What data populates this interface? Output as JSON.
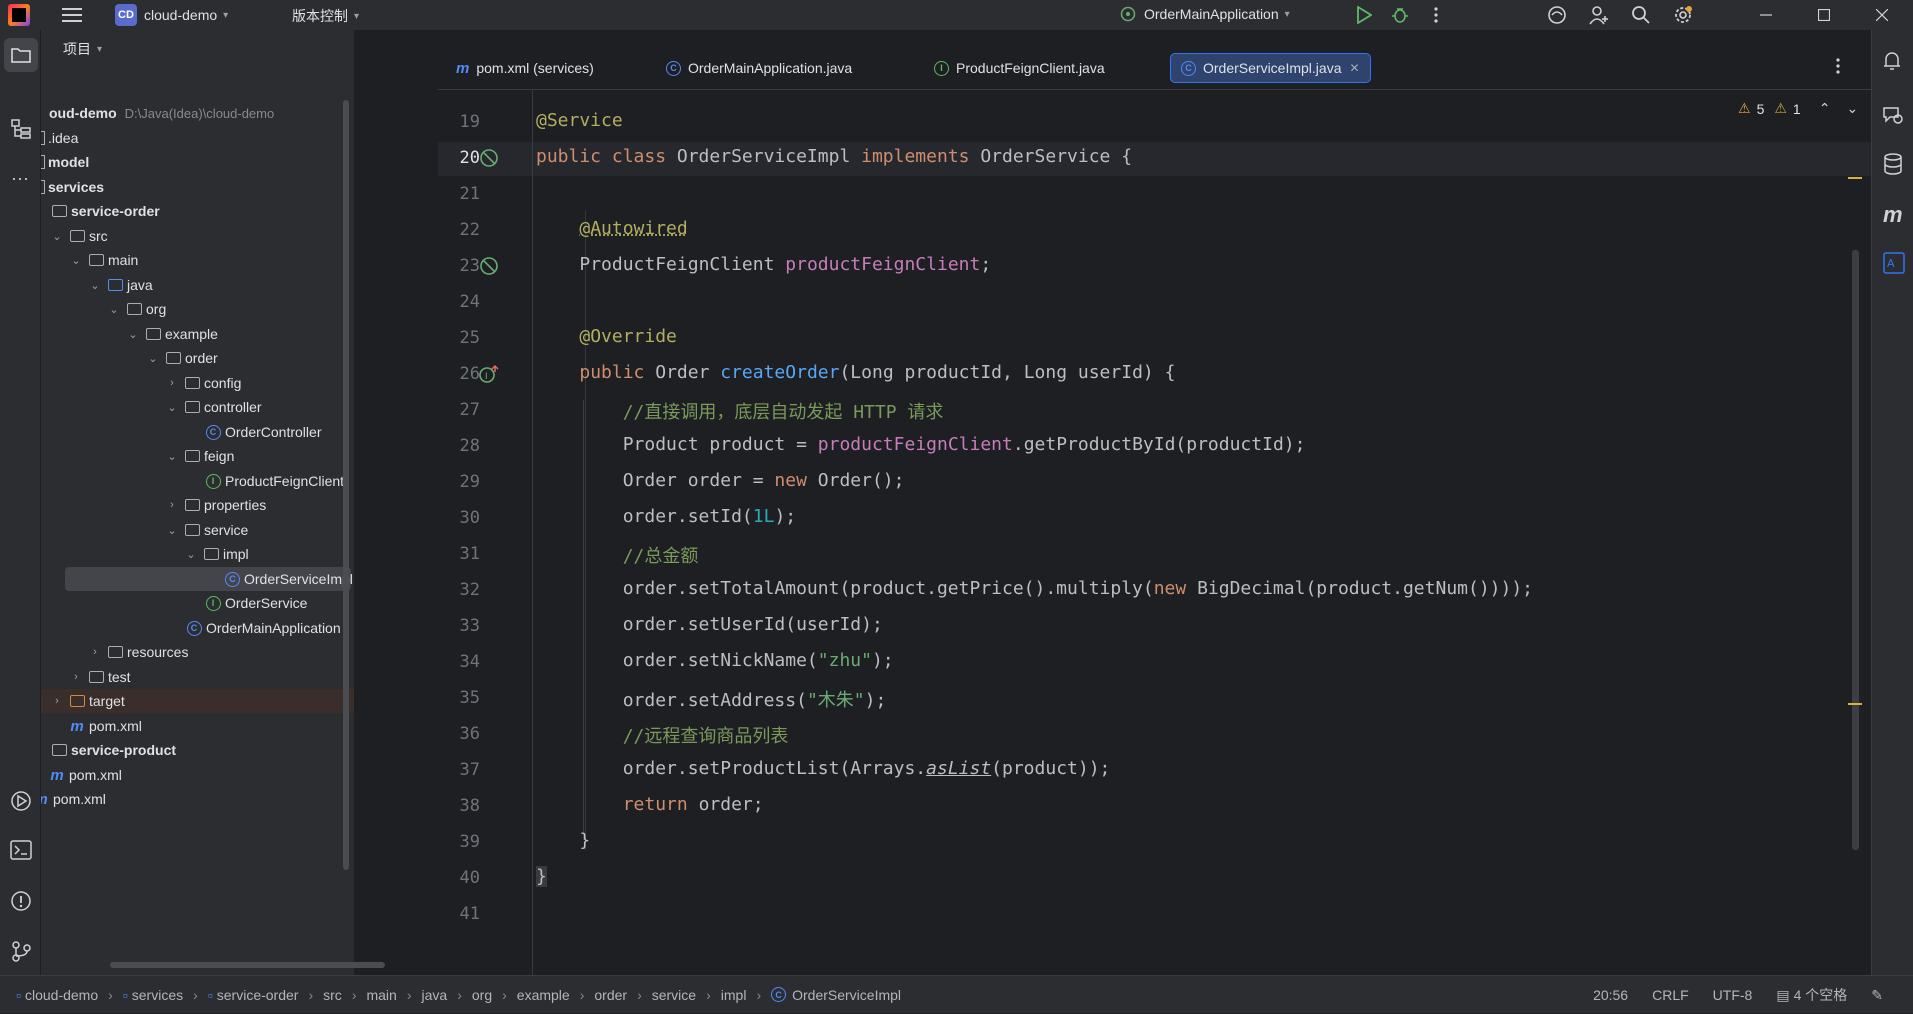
{
  "titlebar": {
    "project_badge": "CD",
    "project_name": "cloud-demo",
    "vcs_label": "版本控制",
    "run_config": "OrderMainApplication"
  },
  "project_panel": {
    "title": "项目",
    "root": {
      "name": "oud-demo",
      "path": "D:\\Java(Idea)\\cloud-demo"
    },
    "items": [
      {
        "label": ".idea"
      },
      {
        "label": "model"
      },
      {
        "label": "services"
      },
      {
        "label": "service-order"
      },
      {
        "label": "src"
      },
      {
        "label": "main"
      },
      {
        "label": "java"
      },
      {
        "label": "org"
      },
      {
        "label": "example"
      },
      {
        "label": "order"
      },
      {
        "label": "config"
      },
      {
        "label": "controller"
      },
      {
        "label": "OrderController"
      },
      {
        "label": "feign"
      },
      {
        "label": "ProductFeignClient"
      },
      {
        "label": "properties"
      },
      {
        "label": "service"
      },
      {
        "label": "impl"
      },
      {
        "label": "OrderServiceImpl"
      },
      {
        "label": "OrderService"
      },
      {
        "label": "OrderMainApplication"
      },
      {
        "label": "resources"
      },
      {
        "label": "test"
      },
      {
        "label": "target"
      },
      {
        "label": "pom.xml"
      },
      {
        "label": "service-product"
      },
      {
        "label": "pom.xml"
      },
      {
        "label": "pom.xml"
      }
    ]
  },
  "tabs": [
    {
      "label": "pom.xml (services)"
    },
    {
      "label": "OrderMainApplication.java"
    },
    {
      "label": "ProductFeignClient.java"
    },
    {
      "label": "OrderServiceImpl.java"
    }
  ],
  "editor": {
    "warnings": "5",
    "weak_warnings": "1",
    "line_numbers": [
      "19",
      "20",
      "21",
      "22",
      "23",
      "24",
      "25",
      "26",
      "27",
      "28",
      "29",
      "30",
      "31",
      "32",
      "33",
      "34",
      "35",
      "36",
      "37",
      "38",
      "39",
      "40",
      "41"
    ],
    "code": {
      "l19": "@Service",
      "l20_kw1": "public class",
      "l20_name": " OrderServiceImpl ",
      "l20_kw2": "implements",
      "l20_rest": " OrderService {",
      "l22": "@Autowired",
      "l23_type": "ProductFeignClient ",
      "l23_field": "productFeignClient",
      "l23_end": ";",
      "l25": "@Override",
      "l26_kw": "public",
      "l26_type": " Order ",
      "l26_fn": "createOrder",
      "l26_rest": "(Long productId, Long userId) {",
      "l27": "//直接调用，底层自动发起 HTTP 请求",
      "l28_a": "Product product = ",
      "l28_field": "productFeignClient",
      "l28_b": ".getProductById(productId);",
      "l29_a": "Order order = ",
      "l29_kw": "new",
      "l29_b": " Order();",
      "l30_a": "order.setId(",
      "l30_num": "1L",
      "l30_b": ");",
      "l31": "//总金额",
      "l32_a": "order.setTotalAmount(product.getPrice().multiply(",
      "l32_kw": "new",
      "l32_b": " BigDecimal(product.getNum())));",
      "l33": "order.setUserId(userId);",
      "l34_a": "order.setNickName(",
      "l34_str": "\"zhu\"",
      "l34_b": ");",
      "l35_a": "order.setAddress(",
      "l35_str": "\"木朱\"",
      "l35_b": ");",
      "l36": "//远程查询商品列表",
      "l37_a": "order.setProductList(Arrays.",
      "l37_static": "asList",
      "l37_b": "(product));",
      "l38_kw": "return",
      "l38_b": " order;",
      "l39": "}",
      "l40": "}"
    }
  },
  "statusbar": {
    "breadcrumb": [
      "cloud-demo",
      "services",
      "service-order",
      "src",
      "main",
      "java",
      "org",
      "example",
      "order",
      "service",
      "impl",
      "OrderServiceImpl"
    ],
    "position": "20:56",
    "line_sep": "CRLF",
    "encoding": "UTF-8",
    "indent": "4 个空格"
  },
  "colors": {
    "accent": "#3574f0",
    "keyword": "#cf8e6d",
    "annotation": "#b3ae60",
    "field": "#c77dbb",
    "function": "#56a8f5",
    "string": "#6aab73",
    "number": "#2aacb8"
  }
}
